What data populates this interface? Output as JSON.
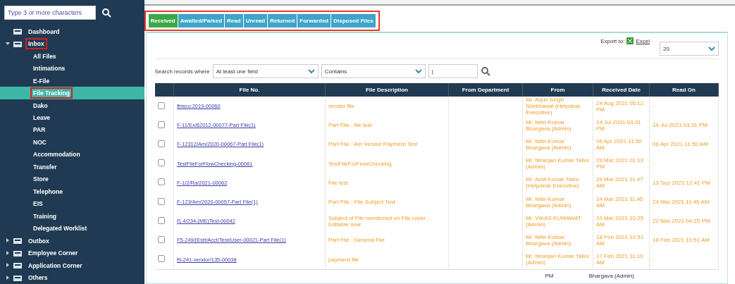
{
  "sidebar": {
    "search": {
      "placeholder": "Type 3 or more characters"
    },
    "items": [
      {
        "label": "Dashboard",
        "annotated": false
      },
      {
        "label": "Inbox",
        "expanded": true,
        "annotated": true,
        "children": [
          {
            "label": "All Files",
            "selected": false,
            "annotated": false
          },
          {
            "label": "Intimations",
            "selected": false,
            "annotated": false
          },
          {
            "label": "E-File",
            "selected": false,
            "annotated": false
          },
          {
            "label": "File Tracking",
            "selected": true,
            "annotated": true
          },
          {
            "label": "Dako",
            "selected": false,
            "annotated": false
          },
          {
            "label": "Leave",
            "selected": false,
            "annotated": false
          },
          {
            "label": "PAR",
            "selected": false,
            "annotated": false
          },
          {
            "label": "NOC",
            "selected": false,
            "annotated": false
          },
          {
            "label": "Accommodation",
            "selected": false,
            "annotated": false
          },
          {
            "label": "Transfer",
            "selected": false,
            "annotated": false
          },
          {
            "label": "Store",
            "selected": false,
            "annotated": false
          },
          {
            "label": "Telephone",
            "selected": false,
            "annotated": false
          },
          {
            "label": "EIS",
            "selected": false,
            "annotated": false
          },
          {
            "label": "Training",
            "selected": false,
            "annotated": false
          },
          {
            "label": "Delegated Worklist",
            "selected": false,
            "annotated": false
          }
        ]
      },
      {
        "label": "Outbox",
        "expanded": false,
        "annotated": false
      },
      {
        "label": "Employee Corner",
        "expanded": false,
        "annotated": false
      },
      {
        "label": "Application Corner",
        "expanded": false,
        "annotated": false
      },
      {
        "label": "Others",
        "expanded": false,
        "annotated": false
      }
    ]
  },
  "tabs": [
    {
      "label": "Received",
      "selected": true
    },
    {
      "label": "Awaited/Parked",
      "selected": false
    },
    {
      "label": "Read",
      "selected": false
    },
    {
      "label": "Unread",
      "selected": false
    },
    {
      "label": "Returned",
      "selected": false
    },
    {
      "label": "Forwarded",
      "selected": false
    },
    {
      "label": "Disposed Files",
      "selected": false
    }
  ],
  "export": {
    "label": "Export to:",
    "link": "Excel"
  },
  "page_size": "20",
  "filter": {
    "label": "Search records where",
    "field": "At least one field",
    "operator": "Contains",
    "value": "|"
  },
  "table": {
    "columns": [
      "File No.",
      "File Description",
      "From Department",
      "From",
      "Received Date",
      "Read On"
    ],
    "rows": [
      {
        "checked": false,
        "file_no": "fbiscu:2019-00060",
        "description": "vendor file",
        "from": "Mr. Arjun Singh Shekhawat (Helpdesk Executive)",
        "received": "24 Aug 2021 05:12 PM",
        "read_on": "-"
      },
      {
        "checked": false,
        "file_no": "F-11/Ex/62012-00077-Part File(1)",
        "description": "Part File : file test",
        "from": "Mr. Nitin Kumar Bhargava (Admin)",
        "received": "14 Jul 2021 03:31 PM",
        "read_on": "14 Jul 2021 03:31 PM"
      },
      {
        "checked": false,
        "file_no": "F-12312/Am/2020-00067-Part File(1)",
        "description": "Part File : Am Vendor Payment Test",
        "from": "Mr. Nitin Kumar Bhargava (Admin)",
        "received": "06 Apr 2021 11:50 AM",
        "read_on": "06 Apr 2021 11:50 AM"
      },
      {
        "checked": false,
        "file_no": "TestFileForFlowChecking-00061",
        "description": "TestFileForFlowChecking",
        "from": "Mr. Niranjan Kumar Tailor (Admin)",
        "received": "29 Mar 2021 01:13 PM",
        "read_on": "-"
      },
      {
        "checked": false,
        "file_no": "F-1/2/Ra/2021-00062",
        "description": "File test",
        "from": "Mr. Amit Kumar Tailor (Helpdesk Executive)",
        "received": "29 Mar 2021 11:47 AM",
        "read_on": "13 Sep 2021 12:41 PM"
      },
      {
        "checked": false,
        "file_no": "F-123/Am/2020-00057-Part File(1)",
        "description": "Part File : File Subject Test",
        "from": "Mr. Nitin Kumar Bhargava (Admin)",
        "received": "24 Mar 2021 11:45 AM",
        "read_on": "24 Mar 2021 11:45 AM"
      },
      {
        "checked": false,
        "file_no": "f1.4/234-(ME)Test-00042",
        "description": "Subject of File mentioned on File cover , Editable now",
        "from": "Mr. VIKAS KUMAWAT (Admin)",
        "received": "10 Mar 2021 10:25 AM",
        "read_on": "22 Mar 2021 04:25 PM"
      },
      {
        "checked": false,
        "file_no": "F5-249/(Estt/Acct/Test/User-00021-Part File(1)",
        "description": "Part File : General File",
        "from": "Mr. Nitin Kumar Bhargava (Admin)",
        "received": "18 Feb 2021 10:51 AM",
        "read_on": "18 Feb 2021 10:51 AM"
      },
      {
        "checked": false,
        "file_no": "f9-241-vendor/135-00038",
        "description": "payment file",
        "from": "Mr. Niranjan Kumar Tailor (Admin)",
        "received": "17 Feb 2021 11:10 AM",
        "read_on": "-"
      }
    ]
  },
  "overlap_strip": [
    "PM",
    "Bhargava (Admin)"
  ]
}
